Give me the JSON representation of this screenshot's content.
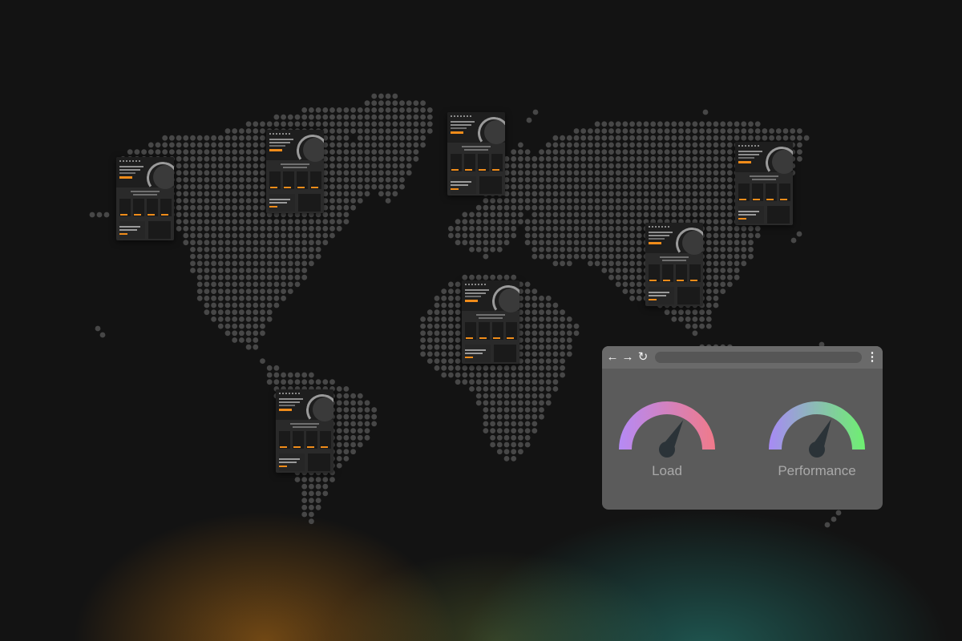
{
  "colors": {
    "background": "#131313",
    "map_dot": "#474747",
    "accent_orange": "#f08c1a",
    "window_body": "#5b5b5b",
    "window_toolbar": "#6a6a6a"
  },
  "site_thumbnails": [
    {
      "name": "north-america-west"
    },
    {
      "name": "north-america-east"
    },
    {
      "name": "europe-north"
    },
    {
      "name": "east-asia"
    },
    {
      "name": "south-asia"
    },
    {
      "name": "africa"
    },
    {
      "name": "south-america"
    }
  ],
  "browser": {
    "toolbar_icons": [
      "back-arrow-icon",
      "forward-arrow-icon",
      "reload-icon",
      "more-options-icon"
    ],
    "gauges": [
      {
        "label": "Load",
        "needle_level": 0.66,
        "gradient": [
          "#b58af5",
          "#f07a8a"
        ]
      },
      {
        "label": "Performance",
        "needle_level": 0.64,
        "gradient": [
          "#a78af5",
          "#6ef070"
        ]
      }
    ]
  }
}
